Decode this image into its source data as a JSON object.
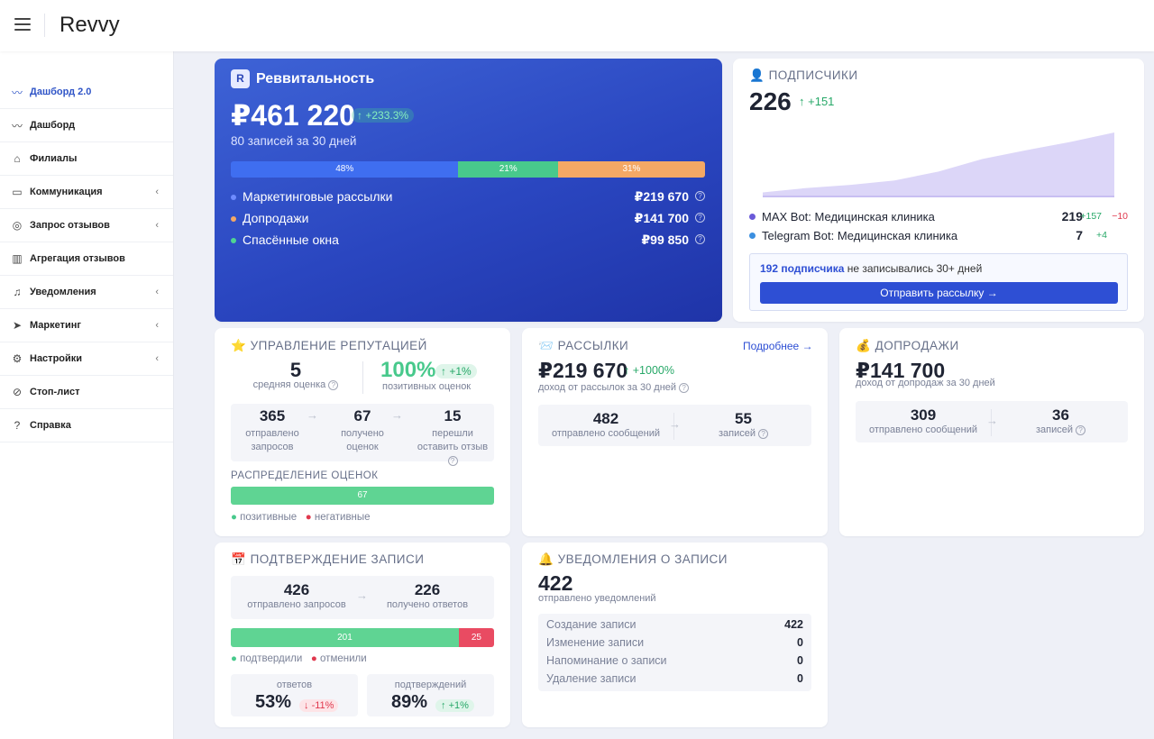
{
  "app": {
    "brand": "Revvy"
  },
  "sidebar": {
    "items": [
      {
        "label": "Дашборд 2.0",
        "icon": "activity-icon",
        "active": true
      },
      {
        "label": "Дашборд",
        "icon": "activity-icon"
      },
      {
        "label": "Филиалы",
        "icon": "home-icon"
      },
      {
        "label": "Коммуникация",
        "icon": "chat-icon",
        "chevron": "‹"
      },
      {
        "label": "Запрос отзывов",
        "icon": "globe-icon",
        "chevron": "‹"
      },
      {
        "label": "Агрегация отзывов",
        "icon": "map-icon"
      },
      {
        "label": "Уведомления",
        "icon": "bell-icon",
        "chevron": "‹"
      },
      {
        "label": "Маркетинг",
        "icon": "navigation-icon",
        "chevron": "‹"
      },
      {
        "label": "Настройки",
        "icon": "gear-icon",
        "chevron": "‹"
      },
      {
        "label": "Стоп-лист",
        "icon": "ban-icon"
      },
      {
        "label": "Справка",
        "icon": "help-icon"
      }
    ]
  },
  "revvitality": {
    "badge": "R",
    "title": "Реввитальность",
    "total": "₽461 220",
    "growth": "+233.3%",
    "subtitle": "80 записей за 30 дней",
    "segments": [
      {
        "label": "48%",
        "value": 48,
        "color": "#3f6ef0"
      },
      {
        "label": "21%",
        "value": 21,
        "color": "#48c98c"
      },
      {
        "label": "31%",
        "value": 31,
        "color": "#f4a865"
      }
    ],
    "rows": [
      {
        "label": "Маркетинговые рассылки",
        "value": "₽219 670",
        "color": "#6f8cff"
      },
      {
        "label": "Допродажи",
        "value": "₽141 700",
        "color": "#f4a865"
      },
      {
        "label": "Спасённые окна",
        "value": "₽99 850",
        "color": "#4fd492"
      }
    ]
  },
  "subscribers": {
    "icon": "👤",
    "title": "ПОДПИСЧИКИ",
    "count": "226",
    "growth": "+151",
    "chart_data": {
      "type": "area",
      "values": [
        0.05,
        0.12,
        0.17,
        0.24,
        0.38,
        0.58,
        0.72,
        0.85,
        1.0
      ]
    },
    "bots": [
      {
        "name": "MAX Bot: Медицинская клиника",
        "count": "219",
        "plus": "+157",
        "minus": "−10",
        "color": "#6a5ad8"
      },
      {
        "name": "Telegram Bot: Медицинская клиника",
        "count": "7",
        "plus": "+4",
        "minus": "",
        "color": "#3b8fe0"
      }
    ],
    "notice_bold": "192 подписчика",
    "notice_rest": " не записывались 30+ дней",
    "button": "Отправить рассылку →"
  },
  "reputation": {
    "icon": "⭐",
    "title": "УПРАВЛЕНИЕ РЕПУТАЦИЕЙ",
    "avg": "5",
    "avg_label": "средняя оценка",
    "positive": "100%",
    "positive_growth": "+1%",
    "positive_label": "позитивных оценок",
    "funnel": [
      {
        "value": "365",
        "label": "отправлено запросов"
      },
      {
        "value": "67",
        "label": "получено оценок"
      },
      {
        "value": "15",
        "label": "перешли оставить отзыв"
      }
    ],
    "dist_title": "РАСПРЕДЕЛЕНИЕ ОЦЕНОК",
    "dist_value": "67",
    "legend_pos": "позитивные",
    "legend_neg": "негативные"
  },
  "mailings": {
    "icon": "📨",
    "title": "РАССЫЛКИ",
    "more": "Подробнее →",
    "total": "₽219 670",
    "growth": "+1000%",
    "sub": "доход от рассылок за 30 дней",
    "sent": "482",
    "sent_label": "отправлено сообщений",
    "records": "55",
    "records_label": "записей"
  },
  "upsell": {
    "icon": "💰",
    "title": "ДОПРОДАЖИ",
    "total": "₽141 700",
    "sub": "доход от допродаж за 30 дней",
    "sent": "309",
    "sent_label": "отправлено сообщений",
    "records": "36",
    "records_label": "записей"
  },
  "confirm": {
    "icon": "📅",
    "title": "ПОДТВЕРЖДЕНИЕ ЗАПИСИ",
    "sent": "426",
    "sent_label": "отправлено запросов",
    "received": "226",
    "received_label": "получено ответов",
    "confirmed": "201",
    "confirmed_value": 201,
    "cancelled": "25",
    "cancelled_value": 25,
    "legend_ok": "подтвердили",
    "legend_cancel": "отменили",
    "answers_label": "ответов",
    "answers": "53%",
    "answers_delta": "-11%",
    "confirms_label": "подтверждений",
    "confirms": "89%",
    "confirms_delta": "+1%"
  },
  "notifications": {
    "icon": "🔔",
    "title": "УВЕДОМЛЕНИЯ О ЗАПИСИ",
    "total": "422",
    "sub": "отправлено уведомлений",
    "rows": [
      {
        "label": "Создание записи",
        "value": "422"
      },
      {
        "label": "Изменение записи",
        "value": "0"
      },
      {
        "label": "Напоминание о записи",
        "value": "0"
      },
      {
        "label": "Удаление записи",
        "value": "0"
      }
    ]
  }
}
